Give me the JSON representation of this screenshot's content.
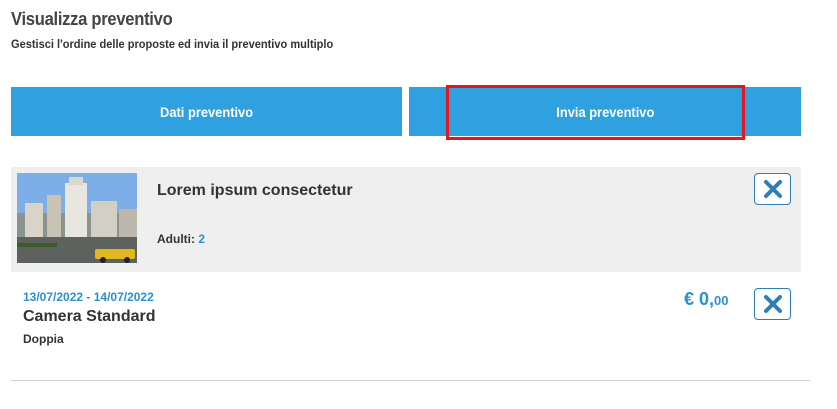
{
  "header": {
    "title": "Visualizza preventivo",
    "subtitle": "Gestisci l'ordine delle proposte ed invia il preventivo multiplo"
  },
  "actions": {
    "dati_label": "Dati preventivo",
    "invia_label": "Invia preventivo"
  },
  "proposal": {
    "hotel_name": "Lorem ipsum consectetur",
    "adults_label": "Adulti:",
    "adults_count": "2",
    "dates": "13/07/2022 - 14/07/2022",
    "room_name": "Camera Standard",
    "room_type": "Doppia",
    "price_main": "€ 0,",
    "price_cents": "00"
  },
  "colors": {
    "accent": "#2fa0e0",
    "highlight": "#e0191e",
    "card_bg": "#efefef",
    "link": "#2a90d0"
  },
  "icons": [
    "close-icon",
    "hotel-photo"
  ]
}
